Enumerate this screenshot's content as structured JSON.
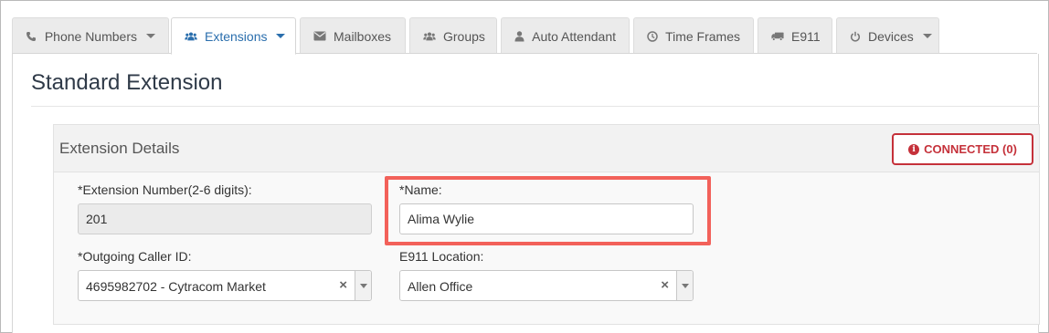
{
  "tabs": [
    {
      "label": "Phone Numbers",
      "icon": "phone-icon",
      "dropdown": true,
      "active": false
    },
    {
      "label": "Extensions",
      "icon": "users-icon",
      "dropdown": true,
      "active": true
    },
    {
      "label": "Mailboxes",
      "icon": "envelope-icon",
      "dropdown": false,
      "active": false
    },
    {
      "label": "Groups",
      "icon": "group-icon",
      "dropdown": false,
      "active": false
    },
    {
      "label": "Auto Attendant",
      "icon": "user-icon",
      "dropdown": false,
      "active": false
    },
    {
      "label": "Time Frames",
      "icon": "clock-icon",
      "dropdown": false,
      "active": false
    },
    {
      "label": "E911",
      "icon": "truck-icon",
      "dropdown": false,
      "active": false
    },
    {
      "label": "Devices",
      "icon": "power-icon",
      "dropdown": true,
      "active": false
    }
  ],
  "page": {
    "title": "Standard Extension"
  },
  "panel": {
    "title": "Extension Details",
    "status_button": "CONNECTED (0)",
    "status_color": "#c5313a"
  },
  "form": {
    "extension_number": {
      "label": "*Extension Number(2-6 digits):",
      "value": "201"
    },
    "name": {
      "label": "*Name:",
      "value": "Alima Wylie"
    },
    "outgoing_caller_id": {
      "label": "*Outgoing Caller ID:",
      "value": "4695982702 - Cytracom Market"
    },
    "e911_location": {
      "label": "E911 Location:",
      "value": "Allen Office"
    }
  },
  "colors": {
    "accent": "#2a6ead",
    "highlight": "#f2615a"
  }
}
